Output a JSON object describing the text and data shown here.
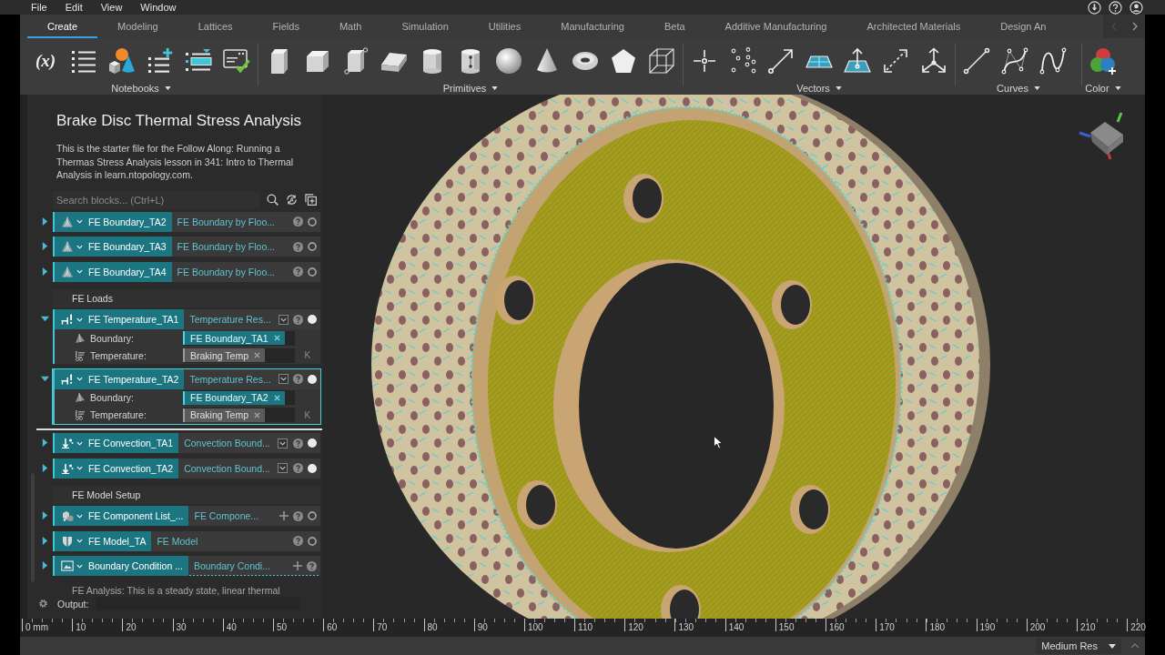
{
  "menu_bar": {
    "items": [
      "File",
      "Edit",
      "View",
      "Window"
    ]
  },
  "ribbon": {
    "tabs": [
      {
        "label": "Create",
        "selected": true
      },
      {
        "label": "Modeling",
        "selected": false
      },
      {
        "label": "Lattices",
        "selected": false
      },
      {
        "label": "Fields",
        "selected": false
      },
      {
        "label": "Math",
        "selected": false
      },
      {
        "label": "Simulation",
        "selected": false
      },
      {
        "label": "Utilities",
        "selected": false
      },
      {
        "label": "Manufacturing",
        "selected": false
      },
      {
        "label": "Beta",
        "selected": false
      },
      {
        "label": "Additive Manufacturing",
        "selected": false
      },
      {
        "label": "Architected Materials",
        "selected": false
      },
      {
        "label": "Design An",
        "selected": false
      }
    ],
    "groups": [
      {
        "kind": "notebooks",
        "label": "Notebooks",
        "symbol": "(x)"
      },
      {
        "kind": "primitives",
        "label": "Primitives"
      },
      {
        "kind": "vectors",
        "label": "Vectors"
      },
      {
        "kind": "curves",
        "label": "Curves"
      },
      {
        "kind": "color",
        "label": "Color"
      }
    ]
  },
  "notebook": {
    "title": "Brake Disc Thermal Stress Analysis",
    "description": "This is the starter file for the Follow Along: Running a Thermas Stress Analysis lesson in 341: Intro to Thermal Analysis in learn.ntopology.com.",
    "search": {
      "placeholder": "Search blocks... (Ctrl+L)"
    },
    "items": [
      {
        "kind": "boundary",
        "name": "FE Boundary_TA2",
        "type": "FE Boundary by Floo...",
        "expanded": false,
        "selected": false,
        "visible": false,
        "type_menu": false,
        "addable": false,
        "drop_target": false
      },
      {
        "kind": "boundary",
        "name": "FE Boundary_TA3",
        "type": "FE Boundary by Floo...",
        "expanded": false,
        "selected": false,
        "visible": false,
        "type_menu": false,
        "addable": false,
        "drop_target": false
      },
      {
        "kind": "boundary",
        "name": "FE Boundary_TA4",
        "type": "FE Boundary by Floo...",
        "expanded": false,
        "selected": false,
        "visible": false,
        "type_menu": false,
        "addable": false,
        "drop_target": false
      },
      {
        "kind": "section",
        "label": "FE Loads"
      },
      {
        "kind": "temperature",
        "name": "FE Temperature_TA1",
        "type": "Temperature Res...",
        "expanded": true,
        "selected": false,
        "visible": true,
        "type_menu": true,
        "addable": false,
        "drop_target": false,
        "params": [
          {
            "kind": "boundary",
            "label": "Boundary:",
            "value": "FE Boundary_TA1"
          },
          {
            "kind": "temperature",
            "label": "Temperature:",
            "value": "Braking Temp",
            "unit": "K"
          }
        ]
      },
      {
        "kind": "temperature",
        "name": "FE Temperature_TA2",
        "type": "Temperature Res...",
        "expanded": true,
        "selected": true,
        "visible": true,
        "type_menu": true,
        "addable": false,
        "drop_target": false,
        "params": [
          {
            "kind": "boundary",
            "label": "Boundary:",
            "value": "FE Boundary_TA2"
          },
          {
            "kind": "temperature",
            "label": "Temperature:",
            "value": "Braking Temp",
            "unit": "K"
          }
        ]
      },
      {
        "kind": "drop-line"
      },
      {
        "kind": "convection",
        "name": "FE Convection_TA1",
        "type": "Convection Bound...",
        "expanded": false,
        "selected": false,
        "visible": true,
        "type_menu": true,
        "addable": false,
        "drop_target": false
      },
      {
        "kind": "convection",
        "name": "FE Convection_TA2",
        "type": "Convection Bound...",
        "expanded": false,
        "selected": false,
        "visible": true,
        "type_menu": true,
        "addable": false,
        "drop_target": false
      },
      {
        "kind": "section",
        "label": "FE Model Setup"
      },
      {
        "kind": "component-list",
        "name": "FE Component List_...",
        "type": "FE Compone...",
        "expanded": false,
        "selected": false,
        "visible": false,
        "type_menu": false,
        "addable": true,
        "drop_target": false
      },
      {
        "kind": "model",
        "name": "FE Model_TA",
        "type": "FE Model",
        "expanded": false,
        "selected": false,
        "visible": false,
        "type_menu": false,
        "addable": false,
        "drop_target": false
      },
      {
        "kind": "condition",
        "name": "Boundary Condition ...",
        "type": "Boundary Condi...",
        "expanded": false,
        "selected": false,
        "type_menu": false,
        "addable": true,
        "drop_target": true
      },
      {
        "kind": "note",
        "text": "FE Analysis: This is a steady state, linear thermal"
      }
    ]
  },
  "output": {
    "label": "Output:"
  },
  "ruler": {
    "labels": [
      "0 mm",
      "10",
      "20",
      "30",
      "40",
      "50",
      "60",
      "70",
      "80",
      "90",
      "100",
      "110",
      "120",
      "130",
      "140",
      "150",
      "160",
      "170",
      "180",
      "190",
      "200",
      "210",
      "220"
    ]
  },
  "status_bar": {
    "resolution": "Medium Res"
  }
}
